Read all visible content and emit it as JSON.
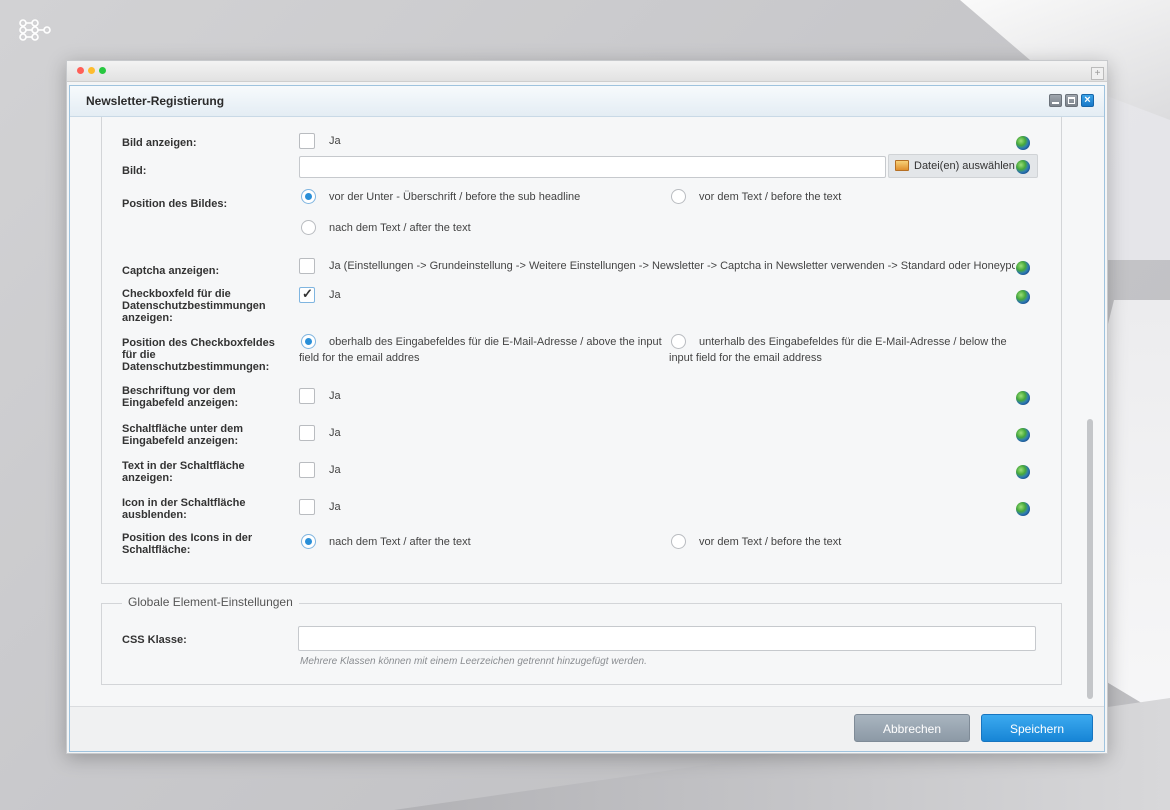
{
  "dialog": {
    "title": "Newsletter-Registierung"
  },
  "icons": {
    "app_logo": "network-nodes-icon",
    "globe": "globe-icon",
    "file": "image-file-icon"
  },
  "form": {
    "bild_anzeigen": {
      "label": "Bild anzeigen:",
      "option": "Ja",
      "checked": false
    },
    "bild": {
      "label": "Bild:",
      "value": "",
      "file_button": "Datei(en) auswählen"
    },
    "position_bild": {
      "label": "Position des Bildes:",
      "options": [
        "vor der Unter - Überschrift / before the sub headline",
        "vor dem Text / before the text",
        "nach dem Text / after the text"
      ],
      "selected": 0
    },
    "captcha": {
      "label": "Captcha anzeigen:",
      "option": "Ja (Einstellungen -> Grundeinstellung -> Weitere Einstellungen -> Newsletter -> Captcha in Newsletter verwenden -> Standard oder Honeypot)",
      "checked": false
    },
    "checkbox_datenschutz": {
      "label": "Checkboxfeld für die Datenschutzbestimmungen anzeigen:",
      "option": "Ja",
      "checked": true
    },
    "position_checkbox": {
      "label": "Position des Checkboxfeldes für die Datenschutzbestimmungen:",
      "options": [
        "oberhalb des Eingabefeldes für die E-Mail-Adresse / above the input field for the email addres",
        "unterhalb des Eingabefeldes für die E-Mail-Adresse / below the input field for the email address"
      ],
      "selected": 0
    },
    "beschriftung": {
      "label": "Beschriftung vor dem Eingabefeld anzeigen:",
      "option": "Ja",
      "checked": false
    },
    "schaltflaeche": {
      "label": "Schaltfläche unter dem Eingabefeld anzeigen:",
      "option": "Ja",
      "checked": false
    },
    "text_schaltflaeche": {
      "label": "Text in der Schaltfläche anzeigen:",
      "option": "Ja",
      "checked": false
    },
    "icon_schaltflaeche": {
      "label": "Icon in der Schaltfläche ausblenden:",
      "option": "Ja",
      "checked": false
    },
    "position_icon": {
      "label": "Position des Icons in der Schaltfläche:",
      "options": [
        "nach dem Text / after the text",
        "vor dem Text / before the text"
      ],
      "selected": 0
    }
  },
  "global": {
    "legend": "Globale Element-Einstellungen",
    "css_label": "CSS Klasse:",
    "css_value": "",
    "hint": "Mehrere Klassen können mit einem Leerzeichen getrennt hinzugefügt werden."
  },
  "footer": {
    "cancel": "Abbrechen",
    "save": "Speichern"
  },
  "colors": {
    "accent": "#1e8ee0",
    "cancel": "#98a4b0"
  }
}
